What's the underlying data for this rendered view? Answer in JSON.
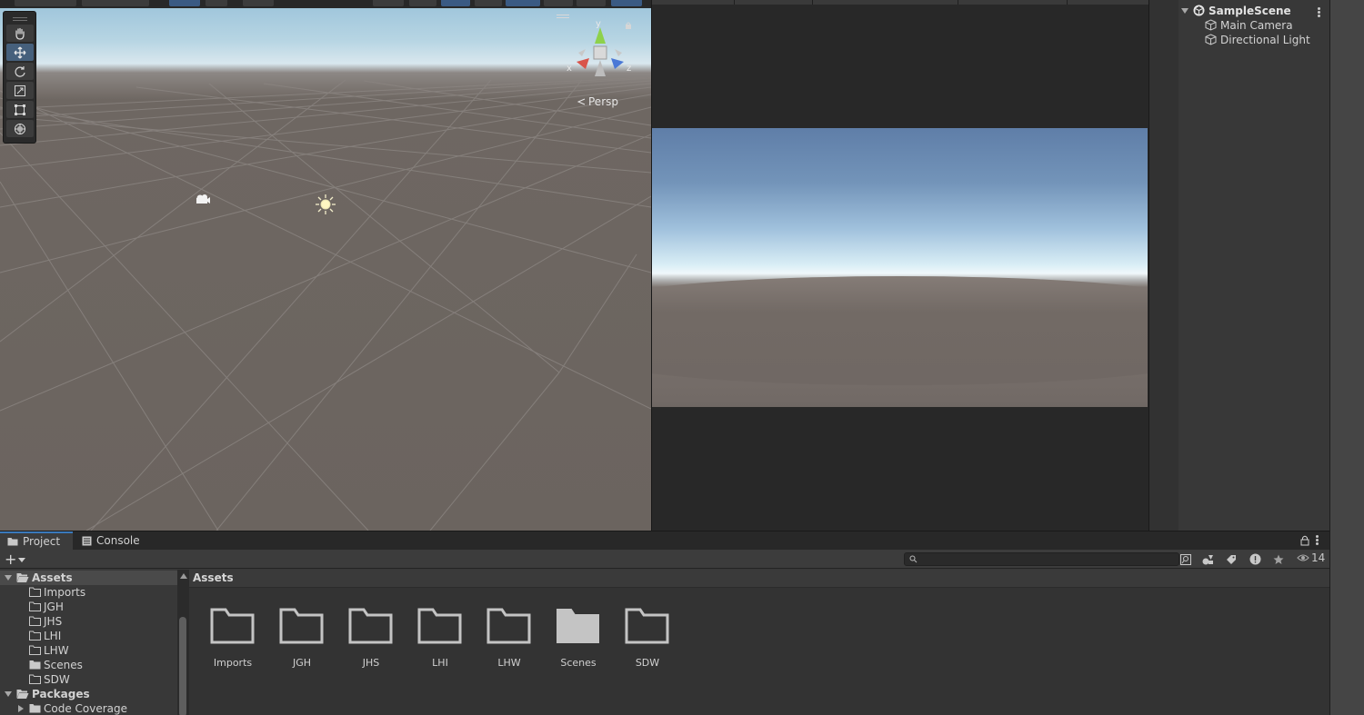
{
  "scene_view": {
    "persp_label": "Persp",
    "gizmo_axes": {
      "x": "x",
      "y": "y",
      "z": "z"
    },
    "tools": [
      "hand-tool",
      "move-tool",
      "rotate-tool",
      "scale-tool",
      "rect-tool",
      "transform-tool"
    ],
    "active_tool": "move-tool"
  },
  "hierarchy": {
    "scene_name": "SampleScene",
    "objects": [
      "Main Camera",
      "Directional Light"
    ]
  },
  "bottom_panel": {
    "tabs": [
      {
        "label": "Project",
        "icon": "folder-icon",
        "active": true
      },
      {
        "label": "Console",
        "icon": "console-icon",
        "active": false
      }
    ],
    "hidden_count": "14",
    "search": {
      "value": "",
      "placeholder": ""
    },
    "tree": {
      "assets_label": "Assets",
      "asset_folders": [
        "Imports",
        "JGH",
        "JHS",
        "LHI",
        "LHW",
        "Scenes",
        "SDW"
      ],
      "packages_label": "Packages",
      "package_items": [
        "Code Coverage"
      ]
    },
    "breadcrumb": "Assets",
    "grid_items": [
      {
        "label": "Imports",
        "filled": false
      },
      {
        "label": "JGH",
        "filled": false
      },
      {
        "label": "JHS",
        "filled": false
      },
      {
        "label": "LHI",
        "filled": false
      },
      {
        "label": "LHW",
        "filled": false
      },
      {
        "label": "Scenes",
        "filled": true
      },
      {
        "label": "SDW",
        "filled": false
      }
    ]
  },
  "colors": {
    "accent": "#3a79bb",
    "active_tool": "#46607c",
    "panel_bg": "#383838",
    "scene_ground": "#6b645f",
    "gizmo_x": "#d9544a",
    "gizmo_y": "#8ed14b",
    "gizmo_z": "#4a78d6"
  }
}
